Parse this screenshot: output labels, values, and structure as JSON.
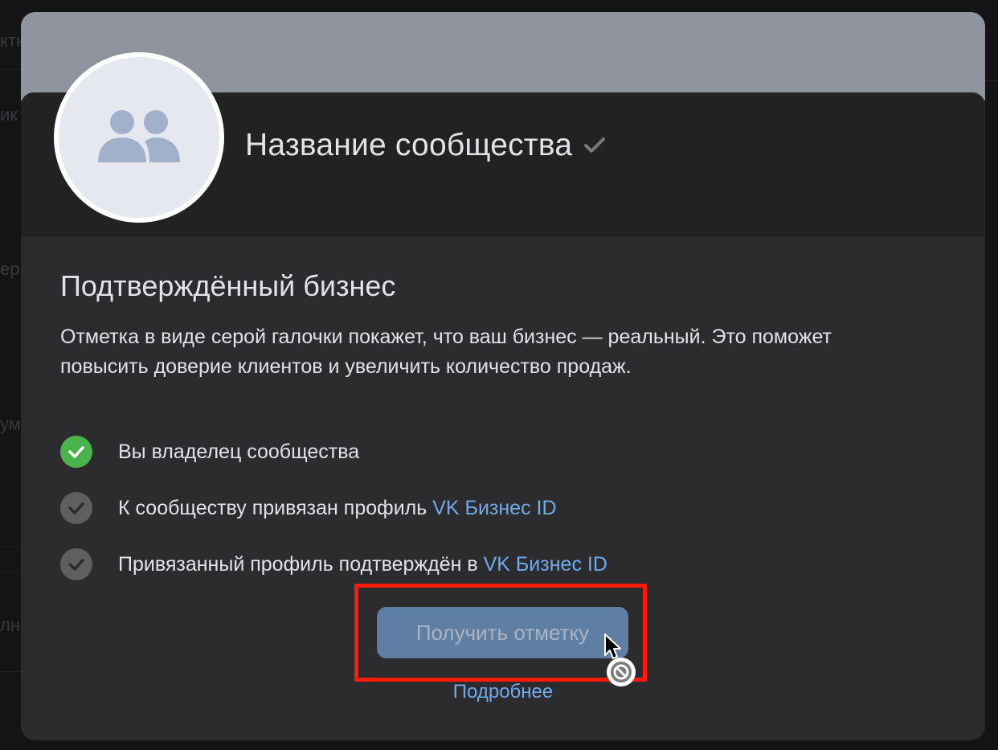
{
  "community": {
    "name": "Название сообщества",
    "verified_icon": "checkmark-icon",
    "avatar_icon": "users-icon"
  },
  "verification": {
    "title": "Подтверждённый бизнес",
    "description": "Отметка в виде серой галочки покажет, что ваш бизнес — реальный. Это поможет повысить доверие клиентов и увеличить количество продаж.",
    "requirements": [
      {
        "text": "Вы владелец сообщества",
        "link": "",
        "status": "done"
      },
      {
        "text": "К сообществу привязан профиль ",
        "link": "VK Бизнес ID",
        "status": "pending"
      },
      {
        "text": "Привязанный профиль подтверждён в ",
        "link": "VK Бизнес ID",
        "status": "pending"
      }
    ],
    "button_label": "Получить отметку",
    "more_link": "Подробнее"
  },
  "background_fragments": [
    "ктн",
    "ик",
    "ер",
    "ум",
    "лн"
  ],
  "colors": {
    "accent_link": "#71aaeb",
    "success": "#4bb34b",
    "highlight": "#ff1a0a",
    "button": "#5f7ea3"
  }
}
